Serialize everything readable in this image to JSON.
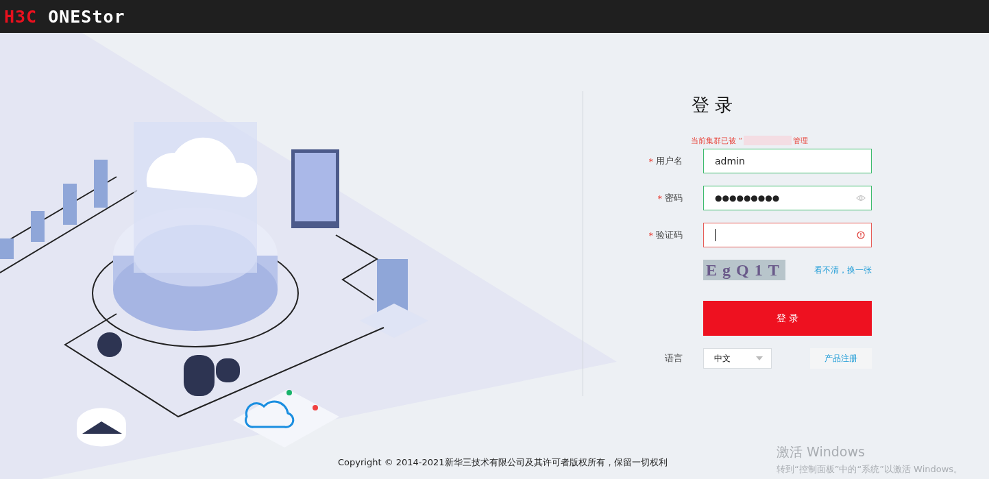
{
  "header": {
    "logo_brand": "H3C",
    "logo_product": "ONEStor"
  },
  "login": {
    "title": "登 录",
    "notice_before": "当前集群已被 “",
    "notice_after": "管理",
    "fields": [
      {
        "kind": "text",
        "label": "用户名",
        "required_mark": "*",
        "value": "admin",
        "valid": true,
        "error": false
      },
      {
        "kind": "password",
        "label": "密码",
        "required_mark": "*",
        "value": "●●●●●●●●●",
        "valid": true,
        "error": false
      },
      {
        "kind": "captcha",
        "label": "验证码",
        "required_mark": "*",
        "error": true
      }
    ],
    "captcha": {
      "text": "EgQ1T",
      "refresh_link": "看不清，换一张"
    },
    "submit": "登 录",
    "language": {
      "label": "语言",
      "value": "中文"
    },
    "register_button": "产品注册"
  },
  "footer": {
    "copyright": "Copyright © 2014-2021新华三技术有限公司及其许可者版权所有，保留一切权利"
  },
  "activation_notice": {
    "title": "激活 Windows",
    "message": "转到“控制面板”中的“系统”以激活 Windows。"
  }
}
